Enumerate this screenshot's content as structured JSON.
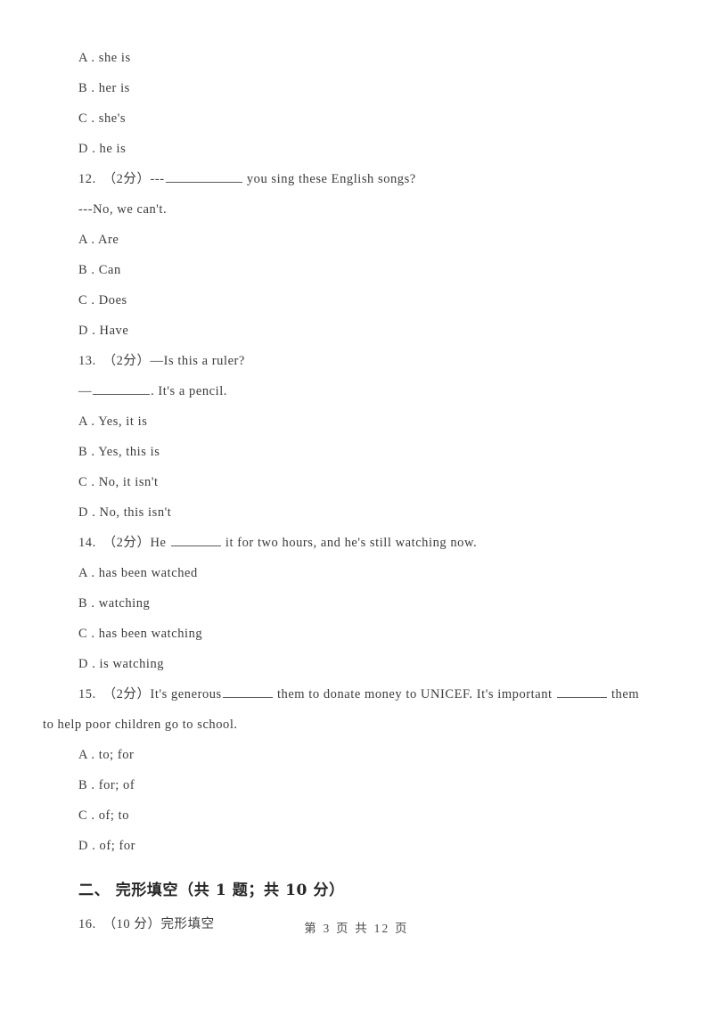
{
  "page": {
    "footer_text": "第 3 页 共 12 页",
    "text_color": "#3c3c3c",
    "background_color": "#ffffff"
  },
  "carryover_options": {
    "a": "A . she is",
    "b": "B . her is",
    "c": "C . she's",
    "d": "D . he is"
  },
  "questions": [
    {
      "number": "12.",
      "marks": "（2分）",
      "stem_before_blank": "12.　（2分）---",
      "stem_after_blank": " you sing these English songs?",
      "reply": "---No, we can't.",
      "options": {
        "a": "A . Are",
        "b": "B . Can",
        "c": "C . Does",
        "d": "D . Have"
      }
    },
    {
      "number": "13.",
      "marks": "（2分）",
      "stem_line1": "13.　（2分）—Is this a ruler?",
      "reply_before_blank": "—",
      "reply_after_blank": ". It's a pencil.",
      "options": {
        "a": "A . Yes, it is",
        "b": "B . Yes, this is",
        "c": "C . No, it isn't",
        "d": "D . No, this isn't"
      }
    },
    {
      "number": "14.",
      "marks": "（2分）",
      "stem_before_blank": "14.　（2分）He ",
      "stem_after_blank": " it for two hours, and he's still watching now.",
      "options": {
        "a": "A . has been watched",
        "b": "B . watching",
        "c": "C . has been watching",
        "d": "D . is watching"
      }
    },
    {
      "number": "15.",
      "marks": "（2分）",
      "stem_part1": "15.　（2分）It's generous",
      "stem_part2": " them to donate money to UNICEF. It's important ",
      "stem_part3": " them",
      "stem_line2": "to help poor children go to school.",
      "options": {
        "a": "A . to; for",
        "b": "B . for; of",
        "c": "C . of; to",
        "d": "D . of; for"
      }
    }
  ],
  "section": {
    "heading": "二、 完形填空（共 1 题；共 10 分）",
    "item": "16.　（10 分）完形填空"
  }
}
